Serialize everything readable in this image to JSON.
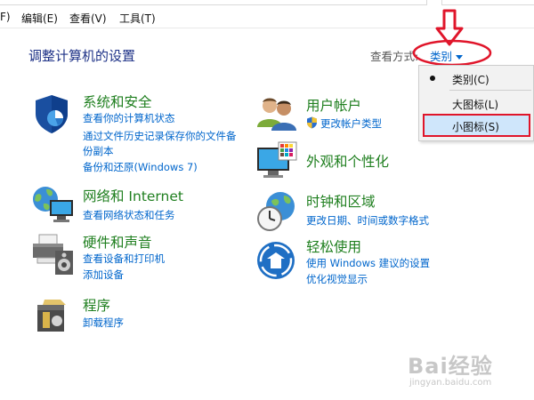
{
  "menu": {
    "items": [
      {
        "label": "F)"
      },
      {
        "label": "编辑(E)"
      },
      {
        "label": "查看(V)"
      },
      {
        "label": "工具(T)"
      }
    ]
  },
  "page_title": "调整计算机的设置",
  "view_by": {
    "label": "查看方式:",
    "selected": "类别",
    "options": [
      "类别(C)",
      "大图标(L)",
      "小图标(S)"
    ]
  },
  "categories": {
    "system_security": {
      "title": "系统和安全",
      "links": [
        "查看你的计算机状态",
        "通过文件历史记录保存你的文件备",
        "份副本",
        "备份和还原(Windows 7)"
      ]
    },
    "network": {
      "title": "网络和 Internet",
      "links": [
        "查看网络状态和任务"
      ]
    },
    "hardware": {
      "title": "硬件和声音",
      "links": [
        "查看设备和打印机",
        "添加设备"
      ]
    },
    "programs": {
      "title": "程序",
      "links": [
        "卸载程序"
      ]
    },
    "user_accounts": {
      "title": "用户帐户",
      "links": [
        "更改帐户类型"
      ]
    },
    "appearance": {
      "title": "外观和个性化",
      "links": []
    },
    "clock": {
      "title": "时钟和区域",
      "links": [
        "更改日期、时间或数字格式"
      ]
    },
    "ease": {
      "title": "轻松使用",
      "links": [
        "使用 Windows 建议的设置",
        "优化视觉显示"
      ]
    }
  },
  "watermark": {
    "text": "Bai经验",
    "sub": "jingyan.baidu.com"
  },
  "colors": {
    "link": "#0066cc",
    "category_title": "#1f7f1f",
    "page_title": "#1e3287",
    "annotation_red": "#e0152a",
    "highlight": "#cfe6fb"
  }
}
